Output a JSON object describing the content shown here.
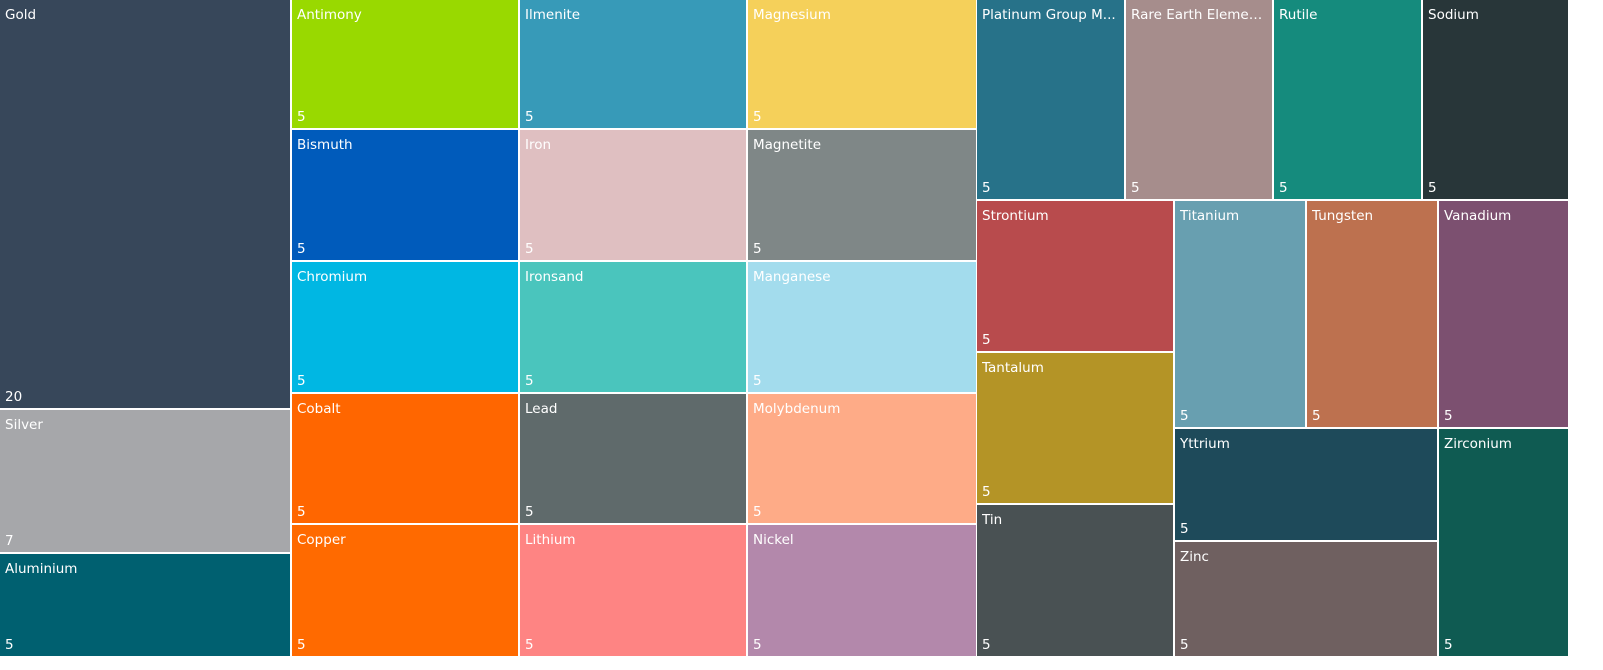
{
  "chart_data": {
    "type": "treemap",
    "items": [
      {
        "name": "Gold",
        "value": 20,
        "color": "#37475a"
      },
      {
        "name": "Silver",
        "value": 7,
        "color": "#a6a7aa"
      },
      {
        "name": "Aluminium",
        "value": 5,
        "color": "#006070"
      },
      {
        "name": "Antimony",
        "value": 5,
        "color": "#99d900"
      },
      {
        "name": "Bismuth",
        "value": 5,
        "color": "#005bbb"
      },
      {
        "name": "Chromium",
        "value": 5,
        "color": "#00b7e3"
      },
      {
        "name": "Cobalt",
        "value": 5,
        "color": "#ff6600"
      },
      {
        "name": "Copper",
        "value": 5,
        "color": "#ff6a00"
      },
      {
        "name": "Ilmenite",
        "value": 5,
        "color": "#379ab8"
      },
      {
        "name": "Iron",
        "value": 5,
        "color": "#dfbfc1"
      },
      {
        "name": "Ironsand",
        "value": 5,
        "color": "#4ac5bd"
      },
      {
        "name": "Lead",
        "value": 5,
        "color": "#5f6a6b"
      },
      {
        "name": "Lithium",
        "value": 5,
        "color": "#fe8483"
      },
      {
        "name": "Magnesium",
        "value": 5,
        "color": "#f5d05a"
      },
      {
        "name": "Magnetite",
        "value": 5,
        "color": "#7f8787"
      },
      {
        "name": "Manganese",
        "value": 5,
        "color": "#a3dced"
      },
      {
        "name": "Molybdenum",
        "value": 5,
        "color": "#feab87"
      },
      {
        "name": "Nickel",
        "value": 5,
        "color": "#b388ab"
      },
      {
        "name": "Platinum Group M...",
        "value": 5,
        "color": "#277289"
      },
      {
        "name": "Rare Earth Elements",
        "value": 5,
        "color": "#a68d8c"
      },
      {
        "name": "Rutile",
        "value": 5,
        "color": "#158b7d"
      },
      {
        "name": "Sodium",
        "value": 5,
        "color": "#283639"
      },
      {
        "name": "Strontium",
        "value": 5,
        "color": "#b84b4d"
      },
      {
        "name": "Tantalum",
        "value": 5,
        "color": "#b49426"
      },
      {
        "name": "Tin",
        "value": 5,
        "color": "#495153"
      },
      {
        "name": "Titanium",
        "value": 5,
        "color": "#689fb0"
      },
      {
        "name": "Tungsten",
        "value": 5,
        "color": "#bd714f"
      },
      {
        "name": "Vanadium",
        "value": 5,
        "color": "#7c5070"
      },
      {
        "name": "Yttrium",
        "value": 5,
        "color": "#1e4a5a"
      },
      {
        "name": "Zinc",
        "value": 5,
        "color": "#6f6060"
      },
      {
        "name": "Zirconium",
        "value": 5,
        "color": "#0f5b52"
      }
    ]
  }
}
